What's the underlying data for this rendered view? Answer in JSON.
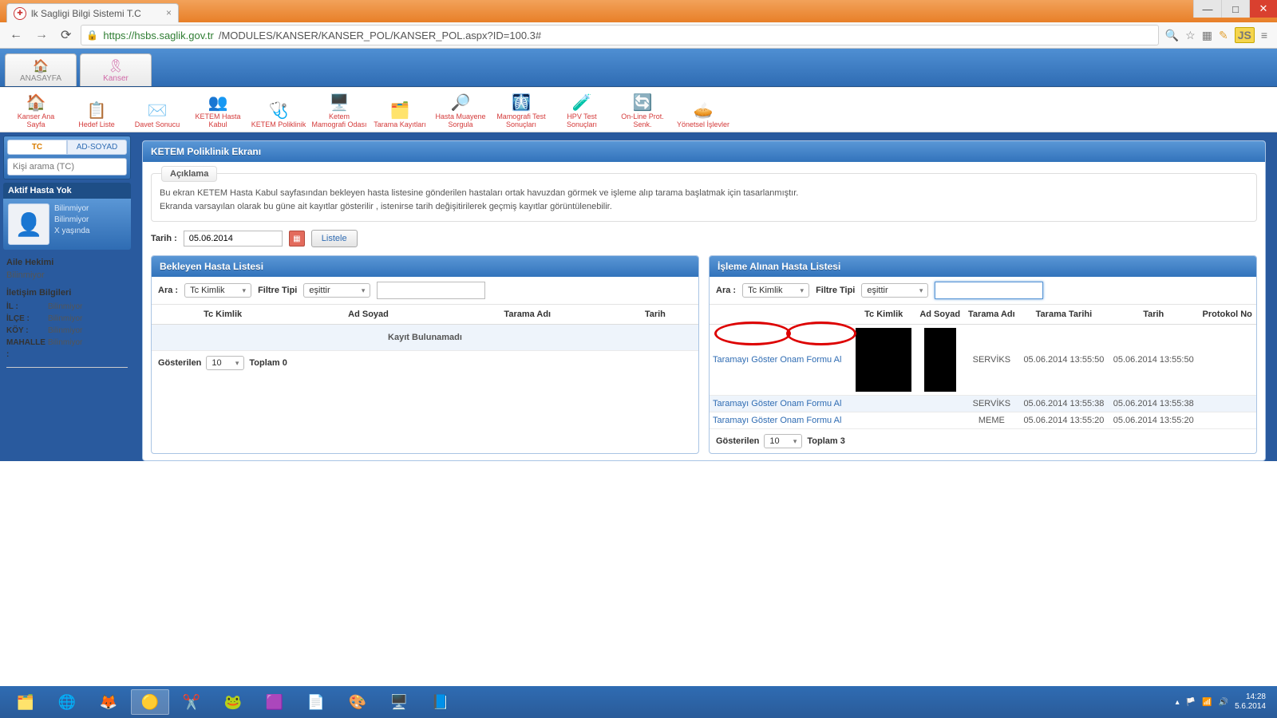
{
  "browser": {
    "tab_title": "lk Sagligi Bilgi Sistemi T.C",
    "url_secure_host": "https://hsbs.saglik.gov.tr",
    "url_path": "/MODULES/KANSER/KANSER_POL/KANSER_POL.aspx?ID=100.3#",
    "win_min": "—",
    "win_max": "□",
    "win_close": "✕"
  },
  "modules": {
    "home": "ANASAYFA",
    "kanser": "Kanser"
  },
  "toolbar": [
    {
      "id": "kanser-ana-sayfa",
      "label": "Kanser Ana Sayfa",
      "icon": "🏠"
    },
    {
      "id": "hedef-liste",
      "label": "Hedef Liste",
      "icon": "📋"
    },
    {
      "id": "davet-sonucu",
      "label": "Davet Sonucu",
      "icon": "✉️"
    },
    {
      "id": "ketem-hasta-kabul",
      "label": "KETEM Hasta Kabul",
      "icon": "👥"
    },
    {
      "id": "ketem-poliklinik",
      "label": "KETEM Poliklinik",
      "icon": "🩺"
    },
    {
      "id": "ketem-mamografi-odasi",
      "label": "Ketem Mamografi Odası",
      "icon": "🖥️"
    },
    {
      "id": "tarama-kayitlari",
      "label": "Tarama Kayıtları",
      "icon": "🗂️"
    },
    {
      "id": "hasta-muayene-sorgula",
      "label": "Hasta Muayene Sorgula",
      "icon": "🔎"
    },
    {
      "id": "mamografi-test-sonuclari",
      "label": "Mamografi Test Sonuçları",
      "icon": "🩻"
    },
    {
      "id": "hpv-test-sonuclari",
      "label": "HPV Test Sonuçları",
      "icon": "🧪"
    },
    {
      "id": "online-prot-senk",
      "label": "On-Line Prot. Senk.",
      "icon": "🔄"
    },
    {
      "id": "yonetsel-islevler",
      "label": "Yönetsel İşlevler",
      "icon": "🥧"
    }
  ],
  "sidebar": {
    "tab_tc": "TC",
    "tab_adsoyad": "AD-SOYAD",
    "search_placeholder": "Kişi arama (TC)",
    "active_header": "Aktif Hasta Yok",
    "p_lines": [
      "Bilinmiyor",
      "Bilinmiyor",
      "X yaşında"
    ],
    "aile_hekimi_h": "Aile Hekimi",
    "aile_hekimi_v": "Bilinmiyor",
    "iletisim_h": "İletişim Bilgileri",
    "kv": [
      {
        "k": "İL :",
        "v": "Bilinmiyor"
      },
      {
        "k": "İLÇE :",
        "v": "Bilinmiyor"
      },
      {
        "k": "KÖY :",
        "v": "Bilinmiyor"
      },
      {
        "k": "MAHALLE :",
        "v": "Bilinmiyor"
      }
    ]
  },
  "main": {
    "panel_title": "KETEM Poliklinik Ekranı",
    "note_tab": "Açıklama",
    "note_line1": "Bu ekran KETEM Hasta Kabul sayfasından bekleyen hasta listesine gönderilen hastaları ortak havuzdan görmek ve işleme alıp tarama başlatmak için tasarlanmıştır.",
    "note_line2": "Ekranda varsayılan olarak bu güne ait kayıtlar gösterilir , istenirse tarih değişitirilerek geçmiş kayıtlar görüntülenebilir.",
    "date_label": "Tarih :",
    "date_value": "05.06.2014",
    "listele": "Listele"
  },
  "left_panel": {
    "title": "Bekleyen Hasta Listesi",
    "ara": "Ara :",
    "sel1": "Tc Kimlik",
    "ftipi": "Filtre Tipi",
    "sel2": "eşittir",
    "cols": [
      "Tc Kimlik",
      "Ad Soyad",
      "Tarama Adı",
      "Tarih"
    ],
    "no_record": "Kayıt Bulunamadı",
    "gosterilen": "Gösterilen",
    "page_size": "10",
    "toplam": "Toplam 0"
  },
  "right_panel": {
    "title": "İşleme Alınan Hasta Listesi",
    "ara": "Ara :",
    "sel1": "Tc Kimlik",
    "ftipi": "Filtre Tipi",
    "sel2": "eşittir",
    "cols": [
      "",
      "Tc Kimlik",
      "Ad Soyad",
      "Tarama Adı",
      "Tarama Tarihi",
      "Tarih",
      "Protokol No"
    ],
    "link_show": "Taramayı Göster",
    "link_form": "Onam Formu Al",
    "rows": [
      {
        "tarama": "SERVİKS",
        "ttarih": "05.06.2014 13:55:50",
        "tarih": "05.06.2014 13:55:50"
      },
      {
        "tarama": "SERVİKS",
        "ttarih": "05.06.2014 13:55:38",
        "tarih": "05.06.2014 13:55:38"
      },
      {
        "tarama": "MEME",
        "ttarih": "05.06.2014 13:55:20",
        "tarih": "05.06.2014 13:55:20"
      }
    ],
    "gosterilen": "Gösterilen",
    "page_size": "10",
    "toplam": "Toplam 3"
  },
  "taskbar": {
    "time": "14:28",
    "date": "5.6.2014"
  }
}
